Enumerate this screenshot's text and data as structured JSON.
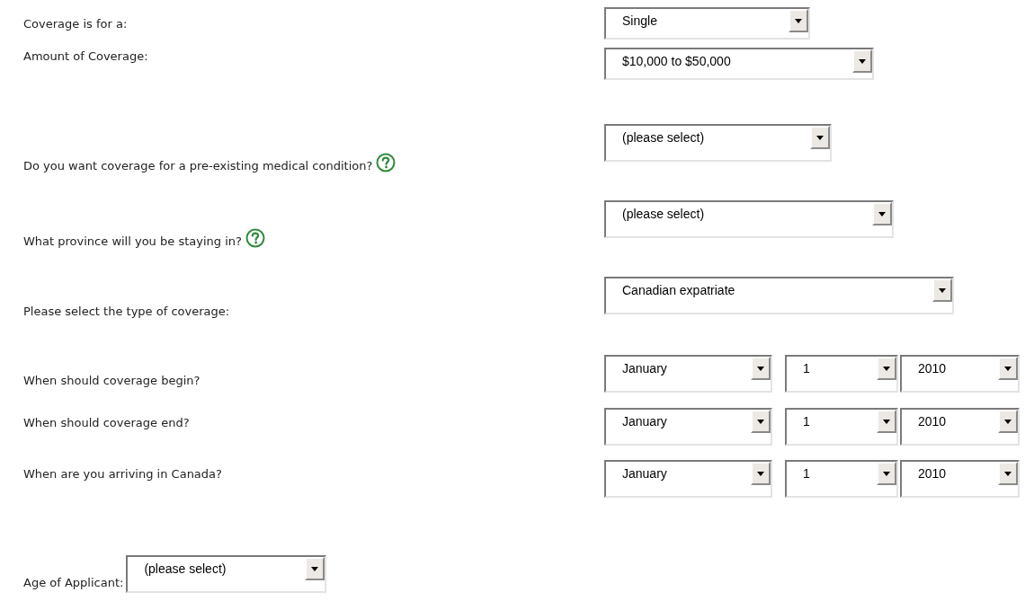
{
  "fields": [
    {
      "label": "Coverage is for a:",
      "help": false,
      "kind": "row",
      "dropdowns": [
        {
          "value": "Single"
        }
      ]
    },
    {
      "label": "Amount of Coverage:",
      "help": false,
      "kind": "row",
      "dropdowns": [
        {
          "value": "$10,000 to $50,000"
        }
      ]
    },
    {
      "label": "Do you want coverage for a pre-existing medical condition?",
      "help": true,
      "kind": "row",
      "dropdowns": [
        {
          "value": "(please select)"
        }
      ]
    },
    {
      "label": "What province will you be staying in?",
      "help": true,
      "kind": "row",
      "dropdowns": [
        {
          "value": "(please select)"
        }
      ]
    },
    {
      "label": "Please select the type of coverage:",
      "help": false,
      "kind": "row",
      "dropdowns": [
        {
          "value": "Canadian expatriate"
        }
      ]
    },
    {
      "label": "When should coverage begin?",
      "help": false,
      "kind": "row",
      "dropdowns": [
        {
          "value": "January"
        },
        {
          "value": "1"
        },
        {
          "value": "2010"
        }
      ]
    },
    {
      "label": "When should coverage end?",
      "help": false,
      "kind": "row",
      "dropdowns": [
        {
          "value": "January"
        },
        {
          "value": "1"
        },
        {
          "value": "2010"
        }
      ]
    },
    {
      "label": "When are you arriving in Canada?",
      "help": false,
      "kind": "row",
      "dropdowns": [
        {
          "value": "January"
        },
        {
          "value": "1"
        },
        {
          "value": "2010"
        }
      ]
    },
    {
      "label": "Age of Applicant:",
      "help": false,
      "kind": "inline",
      "dropdowns": [
        {
          "value": "(please select)"
        }
      ]
    }
  ]
}
